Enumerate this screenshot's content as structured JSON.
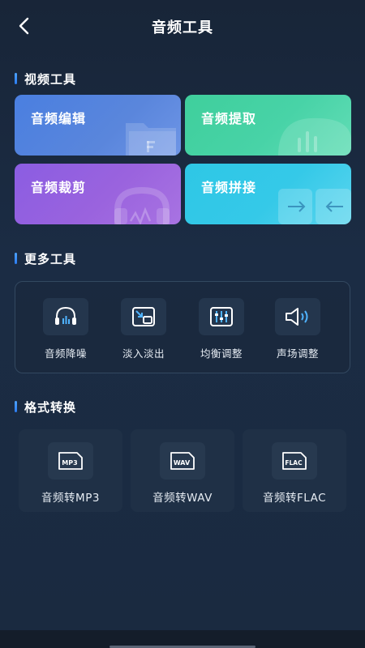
{
  "header": {
    "title": "音频工具",
    "back_icon": "chevron-left-icon"
  },
  "sections": {
    "video_tools": "视频工具",
    "more_tools": "更多工具",
    "format_convert": "格式转换"
  },
  "feature_cards": [
    {
      "label": "音频编辑",
      "icon": "folder-icon",
      "color": "#4a7fe0"
    },
    {
      "label": "音频提取",
      "icon": "waveform-icon",
      "color": "#3fcf9c"
    },
    {
      "label": "音频裁剪",
      "icon": "headphones-icon",
      "color": "#8b5de2"
    },
    {
      "label": "音频拼接",
      "icon": "arrows-icon",
      "color": "#2ec7e6"
    }
  ],
  "more_tools": [
    {
      "label": "音频降噪",
      "icon": "headphones-icon"
    },
    {
      "label": "淡入淡出",
      "icon": "fade-icon"
    },
    {
      "label": "均衡调整",
      "icon": "equalizer-icon"
    },
    {
      "label": "声场调整",
      "icon": "speaker-icon"
    }
  ],
  "formats": [
    {
      "label": "音频转MP3",
      "badge": "MP3",
      "icon": "mp3-file-icon"
    },
    {
      "label": "音频转WAV",
      "badge": "WAV",
      "icon": "wav-file-icon"
    },
    {
      "label": "音频转FLAC",
      "badge": "FLAC",
      "icon": "flac-file-icon"
    }
  ],
  "colors": {
    "background": "#1a2b40",
    "accent": "#4da3ff",
    "icon_accent": "#4fb3ff"
  }
}
